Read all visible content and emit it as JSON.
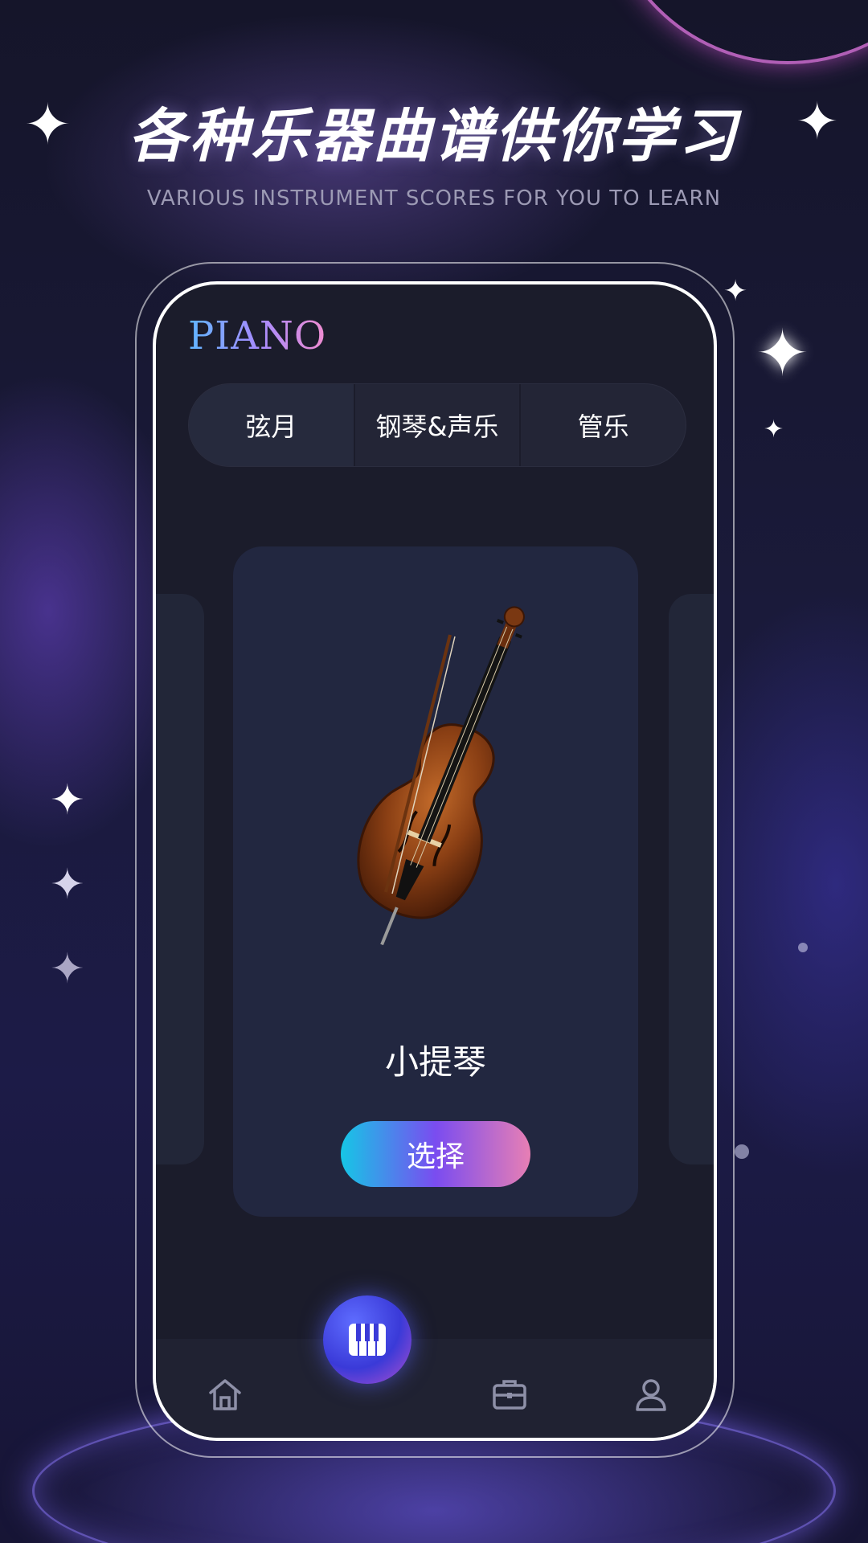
{
  "headline": "各种乐器曲谱供你学习",
  "subheadline": "VARIOUS INSTRUMENT SCORES FOR YOU TO LEARN",
  "app": {
    "logo": "PIANO"
  },
  "tabs": [
    {
      "label": "弦月",
      "active": true
    },
    {
      "label": "钢琴&声乐",
      "active": false
    },
    {
      "label": "管乐",
      "active": false
    }
  ],
  "card": {
    "title": "小提琴",
    "select_label": "选择"
  },
  "nav": {
    "items": [
      {
        "icon": "home-icon"
      },
      {
        "icon": "piano-keys-icon",
        "featured": true
      },
      {
        "icon": "briefcase-icon"
      },
      {
        "icon": "user-icon"
      }
    ]
  },
  "colors": {
    "phone_bg": "#1b1c2b",
    "card_bg": "#222740",
    "button_gradient_start": "#16c6e6",
    "button_gradient_end": "#e77fb4"
  }
}
